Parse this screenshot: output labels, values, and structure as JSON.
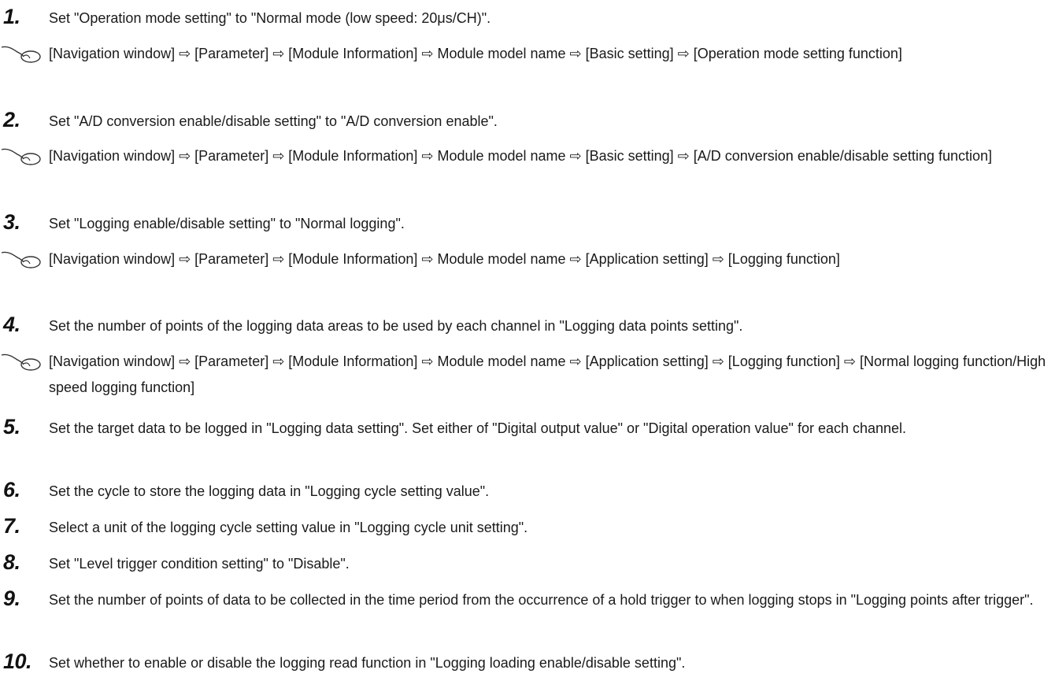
{
  "steps": [
    {
      "number": "1.",
      "text": "Set \"Operation mode setting\" to \"Normal mode (low speed: 20μs/CH)\".",
      "nav": "[Navigation window] ⇨ [Parameter] ⇨ [Module Information] ⇨ Module model name ⇨ [Basic setting] ⇨ [Operation mode setting function]"
    },
    {
      "number": "2.",
      "text": "Set \"A/D conversion enable/disable setting\" to \"A/D conversion enable\".",
      "nav": "[Navigation window] ⇨ [Parameter] ⇨ [Module Information] ⇨ Module model name ⇨ [Basic setting] ⇨ [A/D conversion enable/disable setting function]"
    },
    {
      "number": "3.",
      "text": "Set \"Logging enable/disable setting\" to \"Normal logging\".",
      "nav": "[Navigation window] ⇨ [Parameter] ⇨ [Module Information] ⇨ Module model name ⇨ [Application setting] ⇨ [Logging function]"
    },
    {
      "number": "4.",
      "text": "Set the number of points of the logging data areas to be used by each channel in \"Logging data points setting\".",
      "nav": "[Navigation window] ⇨ [Parameter] ⇨ [Module Information] ⇨ Module model name ⇨ [Application setting] ⇨ [Logging function] ⇨ [Normal logging function/High speed logging function]"
    },
    {
      "number": "5.",
      "text": "Set the target data to be logged in \"Logging data setting\". Set either of \"Digital output value\" or \"Digital operation value\" for each channel."
    },
    {
      "number": "6.",
      "text": "Set the cycle to store the logging data in \"Logging cycle setting value\"."
    },
    {
      "number": "7.",
      "text": "Select a unit of the logging cycle setting value in \"Logging cycle unit setting\"."
    },
    {
      "number": "8.",
      "text": "Set \"Level trigger condition setting\" to \"Disable\"."
    },
    {
      "number": "9.",
      "text": "Set the number of points of data to be collected in the time period from the occurrence of a hold trigger to when logging stops in \"Logging points after trigger\"."
    },
    {
      "number": "10.",
      "text": "Set whether to enable or disable the logging read function in \"Logging loading enable/disable setting\"."
    }
  ],
  "icons": {
    "nav": "mouse-icon"
  }
}
